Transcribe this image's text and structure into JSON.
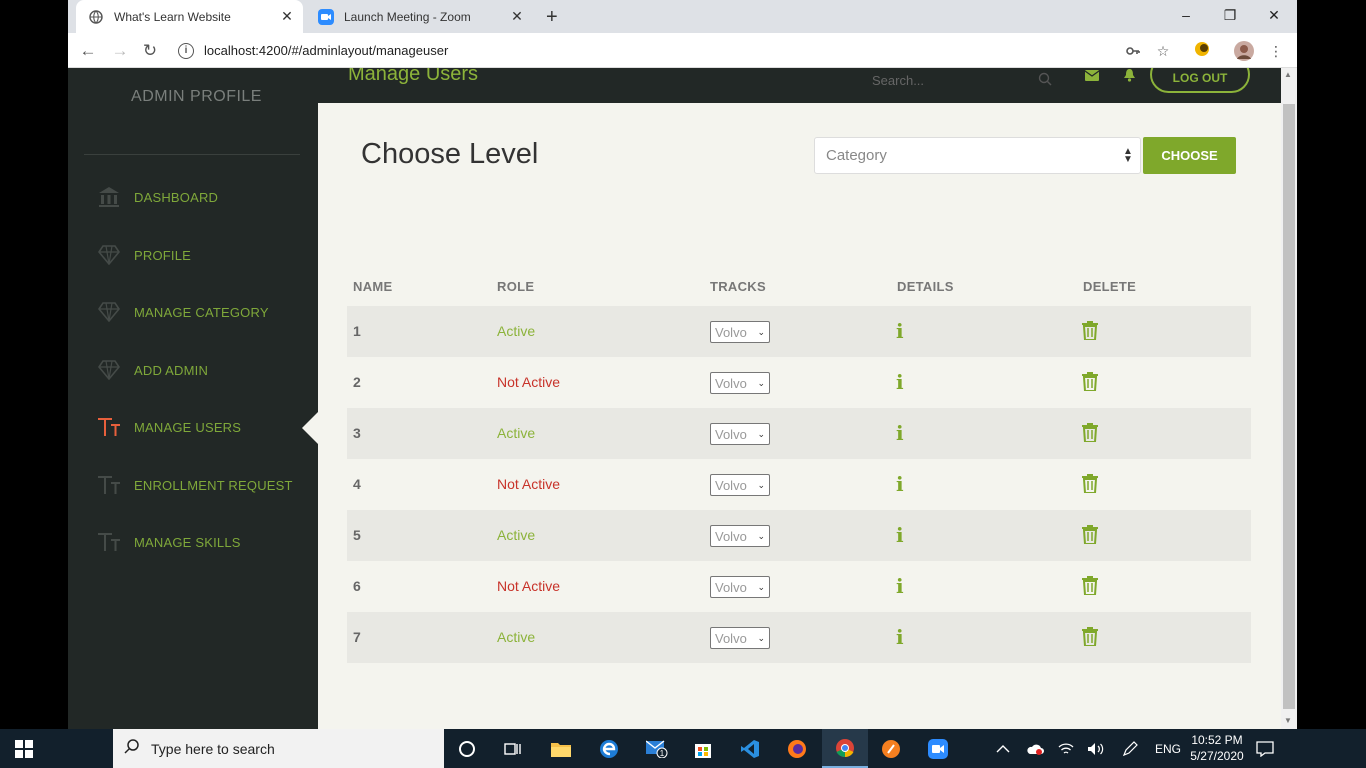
{
  "browser": {
    "tabs": [
      {
        "title": "What's Learn Website",
        "active": true
      },
      {
        "title": "Launch Meeting - Zoom",
        "active": false
      }
    ],
    "url": "localhost:4200/#/adminlayout/manageuser",
    "window_controls": {
      "minimize": "–",
      "restore": "❐",
      "close": "✕"
    }
  },
  "header": {
    "title": "Manage Users",
    "search_placeholder": "Search...",
    "logout_label": "LOG OUT"
  },
  "sidebar": {
    "title": "ADMIN PROFILE",
    "items": [
      {
        "label": "DASHBOARD",
        "icon": "bank-icon",
        "active": false
      },
      {
        "label": "PROFILE",
        "icon": "diamond-icon",
        "active": false
      },
      {
        "label": "MANAGE CATEGORY",
        "icon": "diamond-icon",
        "active": false
      },
      {
        "label": "ADD ADMIN",
        "icon": "diamond-icon",
        "active": false
      },
      {
        "label": "MANAGE USERS",
        "icon": "text-size-icon",
        "active": true
      },
      {
        "label": "ENROLLMENT REQUEST",
        "icon": "text-size-icon",
        "active": false
      },
      {
        "label": "MANAGE SKILLS",
        "icon": "text-size-icon",
        "active": false
      }
    ]
  },
  "main": {
    "heading": "Choose Level",
    "category_placeholder": "Category",
    "choose_label": "CHOOSE",
    "columns": [
      "NAME",
      "ROLE",
      "TRACKS",
      "DETAILS",
      "DELETE"
    ],
    "rows": [
      {
        "name": "1",
        "role": "Active",
        "track": "Volvo",
        "active": true
      },
      {
        "name": "2",
        "role": "Not Active",
        "track": "Volvo",
        "active": false
      },
      {
        "name": "3",
        "role": "Active",
        "track": "Volvo",
        "active": true
      },
      {
        "name": "4",
        "role": "Not Active",
        "track": "Volvo",
        "active": false
      },
      {
        "name": "5",
        "role": "Active",
        "track": "Volvo",
        "active": true
      },
      {
        "name": "6",
        "role": "Not Active",
        "track": "Volvo",
        "active": false
      },
      {
        "name": "7",
        "role": "Active",
        "track": "Volvo",
        "active": true
      }
    ],
    "details_glyph": "i"
  },
  "taskbar": {
    "search_placeholder": "Type here to search",
    "language": "ENG",
    "time": "10:52 PM",
    "date": "5/27/2020",
    "mail_badge": "1"
  },
  "colors": {
    "accent_green": "#8cb33a",
    "inactive_red": "#c8332a",
    "sidebar_bg": "#222826",
    "active_icon": "#e8603c"
  }
}
